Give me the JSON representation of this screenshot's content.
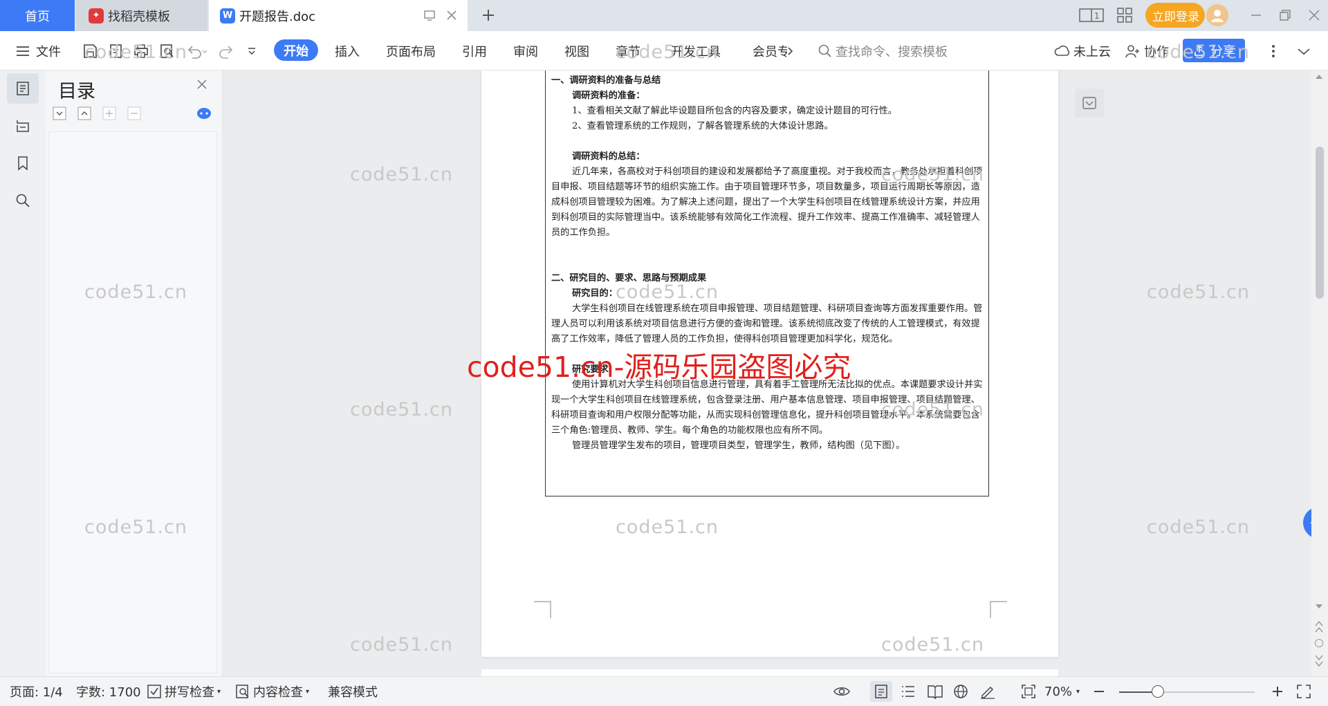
{
  "tabs": {
    "home": "首页",
    "templates": "找稻壳模板",
    "document": "开题报告.doc",
    "login": "立即登录"
  },
  "toolbar": {
    "file": "文件",
    "ribbon": [
      "开始",
      "插入",
      "页面布局",
      "引用",
      "审阅",
      "视图",
      "章节",
      "开发工具",
      "会员专"
    ],
    "search_placeholder": "查找命令、搜索模板",
    "cloud": "未上云",
    "collab": "协作",
    "share": "分享"
  },
  "sidebar": {
    "title": "目录"
  },
  "document": {
    "lines": [
      {
        "style": "h1",
        "text": "一、调研资料的准备与总结"
      },
      {
        "style": "h2",
        "text": "调研资料的准备："
      },
      {
        "style": "ind",
        "text": "1、查看相关文献了解此毕设题目所包含的内容及要求，确定设计题目的可行性。"
      },
      {
        "style": "ind",
        "text": "2、查看管理系统的工作规则，了解各管理系统的大体设计思路。"
      },
      {
        "style": "blank",
        "text": ""
      },
      {
        "style": "h2",
        "text": "调研资料的总结："
      },
      {
        "style": "ind",
        "text": "近几年来，各高校对于科创项目的建设和发展都给予了高度重视。对于我校而言，教务处承担着科创项目申报、项目结题等环节的组织实施工作。由于项目管理环节多，项目数量多，项目运行周期长等原因，造成科创项目管理较为困难。为了解决上述问题，提出了一个大学生科创项目在线管理系统设计方案，并应用到科创项目的实际管理当中。该系统能够有效简化工作流程、提升工作效率、提高工作准确率、减轻管理人员的工作负担。"
      },
      {
        "style": "blank",
        "text": ""
      },
      {
        "style": "blank",
        "text": ""
      },
      {
        "style": "h1",
        "text": "二、研究目的、要求、思路与预期成果"
      },
      {
        "style": "h2",
        "text": "研究目的："
      },
      {
        "style": "ind",
        "text": "大学生科创项目在线管理系统在项目申报管理、项目结题管理、科研项目查询等方面发挥重要作用。管理人员可以利用该系统对项目信息进行方便的查询和管理。该系统彻底改变了传统的人工管理模式，有效提高了工作效率，降低了管理人员的工作负担，使得科创项目管理更加科学化，规范化。"
      },
      {
        "style": "blank",
        "text": ""
      },
      {
        "style": "h2",
        "text": "研究要求："
      },
      {
        "style": "ind",
        "text": "使用计算机对大学生科创项目信息进行管理，具有着手工管理所无法比拟的优点。本课题要求设计并实现一个大学生科创项目在线管理系统，包含登录注册、用户基本信息管理、项目申报管理、项目结题管理、科研项目查询和用户权限分配等功能，从而实现科创管理信息化，提升科创项目管理水平。本系统需要包含三个角色:管理员、教师、学生。每个角色的功能权限也应有所不同。"
      },
      {
        "style": "ind",
        "text": "管理员管理学生发布的项目，管理项目类型，管理学生，教师，结构图（见下图）。"
      }
    ]
  },
  "watermark": {
    "small": "code51.cn",
    "big": "code51.cn-源码乐园盗图必究"
  },
  "status": {
    "page": "页面: 1/4",
    "words": "字数: 1700",
    "spell": "拼写检查",
    "content_check": "内容检查",
    "compat": "兼容模式",
    "zoom": "70%"
  },
  "colors": {
    "accent": "#3d7af5",
    "login": "#f5a623",
    "watermark_red": "#e0201c"
  }
}
